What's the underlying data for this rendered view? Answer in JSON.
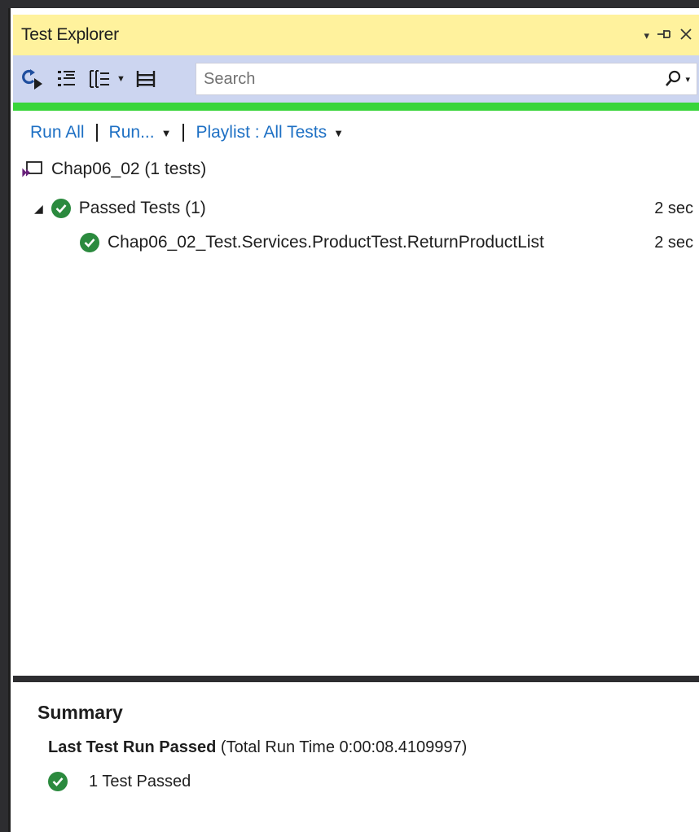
{
  "window": {
    "title": "Test Explorer",
    "controls": {
      "dropdown": "▾",
      "pin": "⊣",
      "close": "✕"
    }
  },
  "toolbar": {
    "tools": [
      {
        "name": "run-tests-icon"
      },
      {
        "name": "group-by-icon"
      },
      {
        "name": "playlist-filter-icon"
      },
      {
        "name": "settings-icon"
      }
    ],
    "search": {
      "placeholder": "Search",
      "value": ""
    }
  },
  "status": {
    "color": "#39d53a"
  },
  "actions": {
    "run_all": "Run All",
    "run": "Run...",
    "playlist": "Playlist : All Tests"
  },
  "project": {
    "label": "Chap06_02 (1 tests)"
  },
  "tree": {
    "group": {
      "label": "Passed Tests (1)",
      "duration": "2 sec"
    },
    "tests": [
      {
        "label": "Chap06_02_Test.Services.ProductTest.ReturnProductList",
        "duration": "2 sec"
      }
    ]
  },
  "summary": {
    "title": "Summary",
    "result_bold": "Last Test Run Passed",
    "result_detail": " (Total Run Time 0:00:08.4109997)",
    "passed": "1 Test Passed"
  },
  "colors": {
    "accent": "#1e70c4",
    "pass": "#2b8a3e",
    "titlebar": "#fff29d",
    "toolbar": "#ccd5f0"
  }
}
